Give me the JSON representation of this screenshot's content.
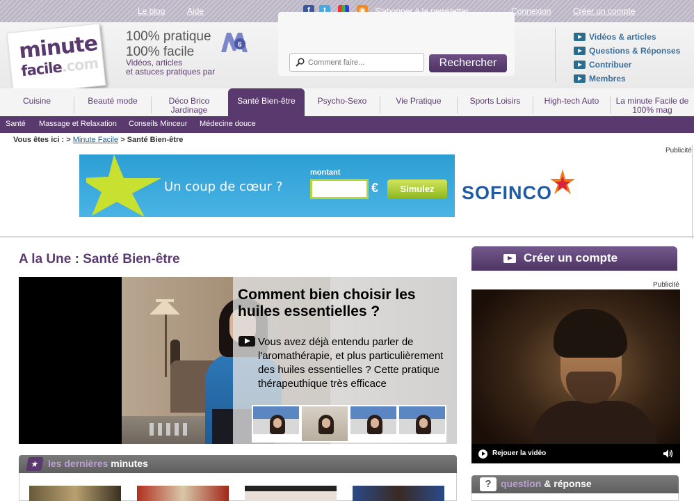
{
  "topbar": {
    "links": [
      {
        "label": "Le blog"
      },
      {
        "label": "Aide"
      },
      {
        "label": "S'abonner à la newsletter"
      },
      {
        "label": "Connexion"
      },
      {
        "label": "Créer un compte"
      }
    ],
    "social_icons": [
      "facebook-icon",
      "twitter-icon",
      "netvibes-icon",
      "rss-icon"
    ]
  },
  "header": {
    "logo_line1": "minute",
    "logo_line2": "facile",
    "logo_line2_suffix": ".com",
    "tagline1": "100% pratique",
    "tagline2": "100% facile",
    "tagline3": "Vidéos, articles",
    "tagline4": "et astuces pratiques par",
    "partner_logo": "M6",
    "search_placeholder": "Comment faire...",
    "search_button": "Rechercher",
    "right_links": [
      {
        "label": "Vidéos & articles"
      },
      {
        "label": "Questions & Réponses"
      },
      {
        "label": "Contribuer"
      },
      {
        "label": "Membres"
      }
    ]
  },
  "nav": {
    "tabs": [
      {
        "label": "Cuisine",
        "active": false
      },
      {
        "label": "Beauté mode",
        "active": false
      },
      {
        "label": "Déco Brico Jardinage",
        "active": false
      },
      {
        "label": "Santé Bien-être",
        "active": true
      },
      {
        "label": "Psycho-Sexo",
        "active": false
      },
      {
        "label": "Vie Pratique",
        "active": false
      },
      {
        "label": "Sports Loisirs",
        "active": false
      },
      {
        "label": "High-tech Auto",
        "active": false
      },
      {
        "label": "La minute Facile de 100% mag",
        "active": false
      }
    ],
    "subitems": [
      {
        "label": "Santé"
      },
      {
        "label": "Massage et Relaxation"
      },
      {
        "label": "Conseils Minceur"
      },
      {
        "label": "Médecine douce"
      }
    ],
    "accent_color": "#5a3a6e"
  },
  "breadcrumb": {
    "prefix": "Vous êtes ici : >",
    "link": "Minute Facile",
    "current": "> Santé Bien-être"
  },
  "ads": {
    "label": "Publicité",
    "banner_text": "Un coup de  cœur ?",
    "banner_montant": "montant",
    "banner_euro": "€",
    "banner_button": "Simulez",
    "banner_brand": "SOFINCO"
  },
  "main": {
    "une_title": "A la Une : Santé Bien-être",
    "feature_title": "Comment bien choisir les huiles essentielles ?",
    "feature_desc": "Vous avez déjà entendu parler de l'aromathérapie, et plus particulièrement des huiles essentielles ? Cette pratique thérapeuthique très efficace",
    "thumbnail_count": 4,
    "dernieres_prefix": "les dernières",
    "dernieres_suffix": "minutes"
  },
  "sidebar": {
    "creer_compte": "Créer un compte",
    "video_publicite": "Publicité",
    "rejouer": "Rejouer la vidéo",
    "qr_prefix": "question",
    "qr_amp": "&",
    "qr_suffix": "réponse",
    "qr_icon_glyph": "?"
  }
}
